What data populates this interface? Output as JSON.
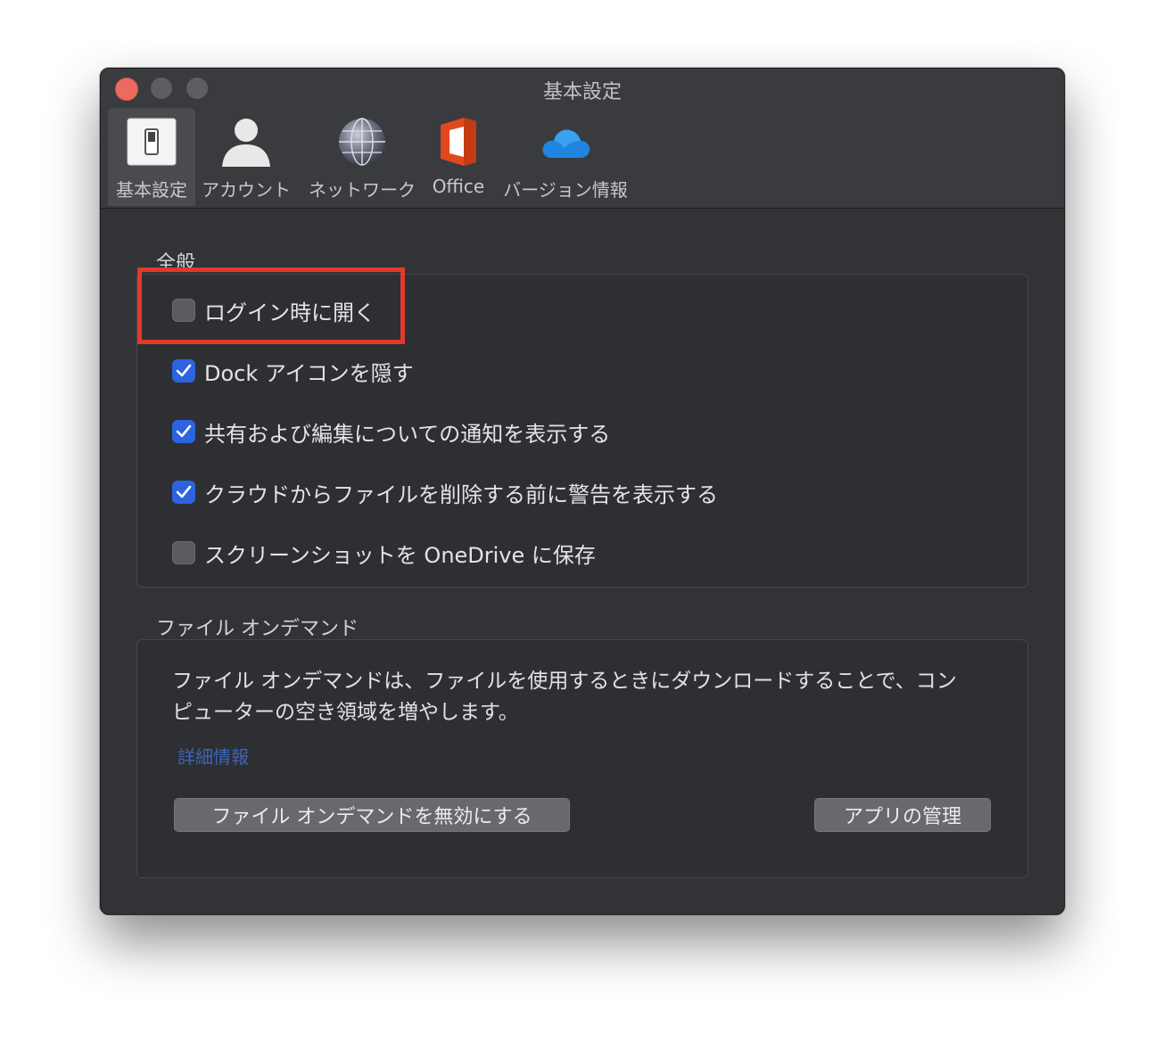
{
  "window": {
    "title": "基本設定"
  },
  "tabs": [
    {
      "label": "基本設定",
      "icon": "switch-icon",
      "active": true
    },
    {
      "label": "アカウント",
      "icon": "person-icon",
      "active": false
    },
    {
      "label": "ネットワーク",
      "icon": "globe-network-icon",
      "active": false
    },
    {
      "label": "Office",
      "icon": "office-logo-icon",
      "active": false
    },
    {
      "label": "バージョン情報",
      "icon": "cloud-icon",
      "active": false
    }
  ],
  "general": {
    "title": "全般",
    "options": [
      {
        "label": "ログイン時に開く",
        "checked": false
      },
      {
        "label": "Dock アイコンを隠す",
        "checked": true
      },
      {
        "label": "共有および編集についての通知を表示する",
        "checked": true
      },
      {
        "label": "クラウドからファイルを削除する前に警告を表示する",
        "checked": true
      },
      {
        "label": "スクリーンショットを OneDrive に保存",
        "checked": false
      }
    ]
  },
  "ondemand": {
    "title": "ファイル オンデマンド",
    "description_line1": "ファイル オンデマンドは、ファイルを使用するときにダウンロードすることで、コン",
    "description_line2": "ピューターの空き領域を増やします。",
    "link": "詳細情報",
    "disable_button": "ファイル オンデマンドを無効にする",
    "manage_button": "アプリの管理"
  },
  "colors": {
    "accent": "#2d63e0",
    "highlight": "#e03a2b",
    "window_bg": "#323337",
    "link": "#3c66b8"
  }
}
